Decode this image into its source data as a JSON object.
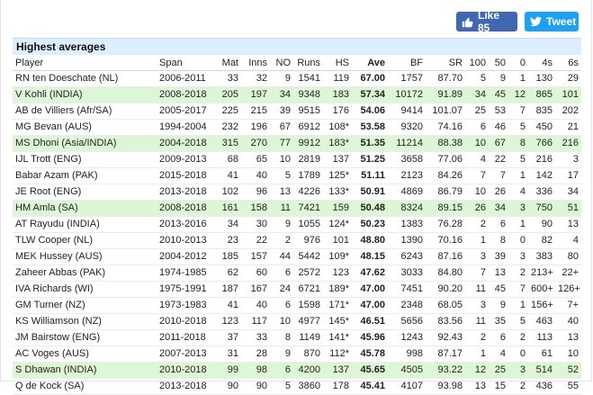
{
  "social": {
    "like_label": "Like 85",
    "tweet_label": "Tweet"
  },
  "table": {
    "title": "Highest averages",
    "columns": [
      "Player",
      "Span",
      "Mat",
      "Inns",
      "NO",
      "Runs",
      "HS",
      "Ave",
      "BF",
      "SR",
      "100",
      "50",
      "0",
      "4s",
      "6s"
    ],
    "rows": [
      {
        "cells": [
          "RN ten Doeschate (NL)",
          "2006-2011",
          "33",
          "32",
          "9",
          "1541",
          "119",
          "67.00",
          "1757",
          "87.70",
          "5",
          "9",
          "1",
          "130",
          "29"
        ],
        "highlight": false
      },
      {
        "cells": [
          "V Kohli (INDIA)",
          "2008-2018",
          "205",
          "197",
          "34",
          "9348",
          "183",
          "57.34",
          "10172",
          "91.89",
          "34",
          "45",
          "12",
          "865",
          "101"
        ],
        "highlight": true
      },
      {
        "cells": [
          "AB de Villiers (Afr/SA)",
          "2005-2017",
          "225",
          "215",
          "39",
          "9515",
          "176",
          "54.06",
          "9414",
          "101.07",
          "25",
          "53",
          "7",
          "835",
          "202"
        ],
        "highlight": false
      },
      {
        "cells": [
          "MG Bevan (AUS)",
          "1994-2004",
          "232",
          "196",
          "67",
          "6912",
          "108*",
          "53.58",
          "9320",
          "74.16",
          "6",
          "46",
          "5",
          "450",
          "21"
        ],
        "highlight": false
      },
      {
        "cells": [
          "MS Dhoni (Asia/INDIA)",
          "2004-2018",
          "315",
          "270",
          "77",
          "9912",
          "183*",
          "51.35",
          "11214",
          "88.38",
          "10",
          "67",
          "8",
          "766",
          "216"
        ],
        "highlight": true
      },
      {
        "cells": [
          "IJL Trott (ENG)",
          "2009-2013",
          "68",
          "65",
          "10",
          "2819",
          "137",
          "51.25",
          "3658",
          "77.06",
          "4",
          "22",
          "5",
          "216",
          "3"
        ],
        "highlight": false
      },
      {
        "cells": [
          "Babar Azam (PAK)",
          "2015-2018",
          "41",
          "40",
          "5",
          "1789",
          "125*",
          "51.11",
          "2123",
          "84.26",
          "7",
          "7",
          "1",
          "142",
          "17"
        ],
        "highlight": false
      },
      {
        "cells": [
          "JE Root (ENG)",
          "2013-2018",
          "102",
          "96",
          "13",
          "4226",
          "133*",
          "50.91",
          "4869",
          "86.79",
          "10",
          "26",
          "4",
          "336",
          "34"
        ],
        "highlight": false
      },
      {
        "cells": [
          "HM Amla (SA)",
          "2008-2018",
          "161",
          "158",
          "11",
          "7421",
          "159",
          "50.48",
          "8324",
          "89.15",
          "26",
          "34",
          "3",
          "750",
          "51"
        ],
        "highlight": true
      },
      {
        "cells": [
          "AT Rayudu (INDIA)",
          "2013-2016",
          "34",
          "30",
          "9",
          "1055",
          "124*",
          "50.23",
          "1383",
          "76.28",
          "2",
          "6",
          "1",
          "90",
          "13"
        ],
        "highlight": false
      },
      {
        "cells": [
          "TLW Cooper (NL)",
          "2010-2013",
          "23",
          "22",
          "2",
          "976",
          "101",
          "48.80",
          "1390",
          "70.16",
          "1",
          "8",
          "0",
          "82",
          "4"
        ],
        "highlight": false
      },
      {
        "cells": [
          "MEK Hussey (AUS)",
          "2004-2012",
          "185",
          "157",
          "44",
          "5442",
          "109*",
          "48.15",
          "6243",
          "87.16",
          "3",
          "39",
          "3",
          "383",
          "80"
        ],
        "highlight": false
      },
      {
        "cells": [
          "Zaheer Abbas (PAK)",
          "1974-1985",
          "62",
          "60",
          "6",
          "2572",
          "123",
          "47.62",
          "3033",
          "84.80",
          "7",
          "13",
          "2",
          "213+",
          "22+"
        ],
        "highlight": false
      },
      {
        "cells": [
          "IVA Richards (WI)",
          "1975-1991",
          "187",
          "167",
          "24",
          "6721",
          "189*",
          "47.00",
          "7451",
          "90.20",
          "11",
          "45",
          "7",
          "600+",
          "126+"
        ],
        "highlight": false
      },
      {
        "cells": [
          "GM Turner (NZ)",
          "1973-1983",
          "41",
          "40",
          "6",
          "1598",
          "171*",
          "47.00",
          "2348",
          "68.05",
          "3",
          "9",
          "1",
          "156+",
          "7+"
        ],
        "highlight": false
      },
      {
        "cells": [
          "KS Williamson (NZ)",
          "2010-2018",
          "123",
          "117",
          "10",
          "4977",
          "145*",
          "46.51",
          "5656",
          "83.56",
          "11",
          "35",
          "5",
          "463",
          "40"
        ],
        "highlight": false
      },
      {
        "cells": [
          "JM Bairstow (ENG)",
          "2011-2018",
          "37",
          "33",
          "8",
          "1149",
          "141*",
          "45.96",
          "1243",
          "92.43",
          "2",
          "6",
          "2",
          "113",
          "13"
        ],
        "highlight": false
      },
      {
        "cells": [
          "AC Voges (AUS)",
          "2007-2013",
          "31",
          "28",
          "9",
          "870",
          "112*",
          "45.78",
          "998",
          "87.17",
          "1",
          "4",
          "0",
          "61",
          "10"
        ],
        "highlight": false
      },
      {
        "cells": [
          "S Dhawan (INDIA)",
          "2010-2018",
          "99",
          "98",
          "6",
          "4200",
          "137",
          "45.65",
          "4505",
          "93.22",
          "12",
          "25",
          "3",
          "514",
          "52"
        ],
        "highlight": true
      },
      {
        "cells": [
          "Q de Kock (SA)",
          "2013-2018",
          "90",
          "90",
          "5",
          "3860",
          "178",
          "45.41",
          "4107",
          "93.98",
          "13",
          "15",
          "2",
          "436",
          "55"
        ],
        "highlight": false
      }
    ]
  },
  "colors": {
    "facebook": "#4267b2",
    "twitter": "#1da1f2",
    "caption_bg": "#ddeeff",
    "highlight_row": "#ddf7d6"
  }
}
